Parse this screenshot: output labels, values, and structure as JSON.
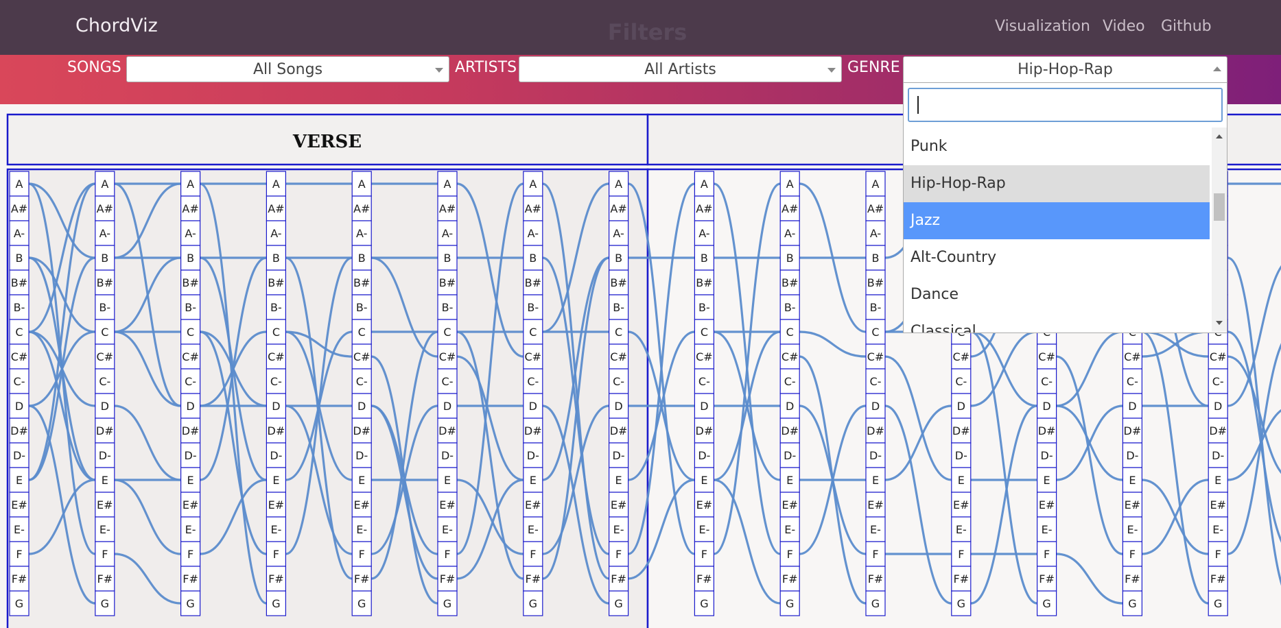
{
  "nav": {
    "brand": "ChordViz",
    "center_title": "Filters",
    "links": [
      "Visualization",
      "Video",
      "Github"
    ]
  },
  "filters": {
    "songs_label": "SONGS",
    "songs_value": "All Songs",
    "artists_label": "ARTISTS",
    "artists_value": "All Artists",
    "genre_label": "GENRE",
    "genre_value": "Hip-Hop-Rap"
  },
  "genre_dropdown": {
    "search_value": "",
    "options": [
      "Punk",
      "Hip-Hop-Rap",
      "Jazz",
      "Alt-Country",
      "Dance",
      "Classical"
    ],
    "hovered": "Hip-Hop-Rap",
    "highlighted": "Jazz"
  },
  "sections": [
    {
      "label": "VERSE"
    },
    {
      "label": ""
    }
  ],
  "notes": [
    "A",
    "A#",
    "A-",
    "B",
    "B#",
    "B-",
    "C",
    "C#",
    "C-",
    "D",
    "D#",
    "D-",
    "E",
    "E#",
    "E-",
    "F",
    "F#",
    "G"
  ],
  "colors": {
    "link": "#5b8ccc",
    "column_border": "#1a1acc",
    "section_border": "#1a1acc",
    "dropdown_highlight": "#5897fb",
    "nav_bg": "#4c3a4b"
  },
  "chart_data": {
    "type": "chord-transition-flow",
    "columns": 16,
    "rows": [
      "A",
      "A#",
      "A-",
      "B",
      "B#",
      "B-",
      "C",
      "C#",
      "C-",
      "D",
      "D#",
      "D-",
      "E",
      "E#",
      "E-",
      "F",
      "F#",
      "G"
    ],
    "transitions": [
      [
        [
          0,
          3
        ],
        [
          3,
          6
        ],
        [
          6,
          12
        ],
        [
          12,
          0
        ],
        [
          9,
          6
        ],
        [
          6,
          0
        ],
        [
          0,
          15
        ],
        [
          15,
          12
        ],
        [
          3,
          12
        ],
        [
          12,
          3
        ],
        [
          6,
          9
        ],
        [
          9,
          17
        ]
      ],
      [
        [
          0,
          0
        ],
        [
          3,
          3
        ],
        [
          6,
          9
        ],
        [
          12,
          15
        ],
        [
          9,
          12
        ],
        [
          6,
          6
        ],
        [
          3,
          0
        ],
        [
          12,
          12
        ],
        [
          15,
          17
        ],
        [
          6,
          3
        ],
        [
          0,
          9
        ]
      ],
      [
        [
          0,
          0
        ],
        [
          3,
          3
        ],
        [
          9,
          6
        ],
        [
          6,
          9
        ],
        [
          15,
          12
        ],
        [
          12,
          3
        ],
        [
          9,
          9
        ],
        [
          6,
          15
        ],
        [
          3,
          12
        ],
        [
          0,
          17
        ]
      ],
      [
        [
          0,
          0
        ],
        [
          6,
          12
        ],
        [
          3,
          3
        ],
        [
          9,
          15
        ],
        [
          12,
          6
        ],
        [
          6,
          7
        ],
        [
          9,
          9
        ],
        [
          3,
          16
        ],
        [
          15,
          3
        ]
      ],
      [
        [
          3,
          7
        ],
        [
          9,
          15
        ],
        [
          6,
          6
        ],
        [
          12,
          12
        ],
        [
          15,
          9
        ],
        [
          3,
          3
        ],
        [
          7,
          17
        ],
        [
          0,
          0
        ],
        [
          9,
          16
        ],
        [
          16,
          6
        ]
      ],
      [
        [
          6,
          6
        ],
        [
          7,
          12
        ],
        [
          12,
          15
        ],
        [
          9,
          9
        ],
        [
          15,
          0
        ],
        [
          3,
          3
        ],
        [
          0,
          7
        ],
        [
          16,
          12
        ],
        [
          6,
          16
        ]
      ],
      [
        [
          6,
          0
        ],
        [
          12,
          3
        ],
        [
          15,
          9
        ],
        [
          9,
          17
        ],
        [
          3,
          15
        ],
        [
          0,
          16
        ],
        [
          6,
          6
        ],
        [
          16,
          3
        ]
      ],
      [
        [
          3,
          3
        ],
        [
          6,
          12
        ],
        [
          12,
          6
        ],
        [
          9,
          9
        ],
        [
          0,
          15
        ],
        [
          15,
          0
        ],
        [
          16,
          12
        ]
      ],
      [
        [
          3,
          3
        ],
        [
          6,
          12
        ],
        [
          12,
          6
        ],
        [
          9,
          9
        ],
        [
          0,
          15
        ],
        [
          15,
          0
        ],
        [
          6,
          6
        ],
        [
          12,
          17
        ]
      ],
      [
        [
          3,
          3
        ],
        [
          6,
          7
        ],
        [
          12,
          12
        ],
        [
          9,
          15
        ],
        [
          15,
          9
        ],
        [
          0,
          6
        ],
        [
          7,
          17
        ]
      ],
      [
        [
          3,
          0
        ],
        [
          6,
          6
        ],
        [
          7,
          12
        ],
        [
          12,
          9
        ],
        [
          9,
          17
        ],
        [
          15,
          15
        ],
        [
          6,
          3
        ]
      ],
      [
        [
          6,
          9
        ],
        [
          12,
          12
        ],
        [
          9,
          6
        ],
        [
          15,
          15
        ],
        [
          7,
          3
        ],
        [
          17,
          9
        ],
        [
          6,
          17
        ]
      ],
      [
        [
          6,
          6
        ],
        [
          9,
          12
        ],
        [
          12,
          9
        ],
        [
          15,
          17
        ],
        [
          7,
          15
        ],
        [
          3,
          3
        ],
        [
          9,
          6
        ]
      ],
      [
        [
          6,
          7
        ],
        [
          12,
          15
        ],
        [
          9,
          9
        ],
        [
          15,
          12
        ],
        [
          7,
          6
        ],
        [
          3,
          9
        ],
        [
          6,
          17
        ]
      ],
      [
        [
          7,
          12
        ],
        [
          9,
          3
        ],
        [
          12,
          9
        ],
        [
          15,
          6
        ],
        [
          6,
          15
        ],
        [
          0,
          0
        ],
        [
          3,
          17
        ]
      ]
    ]
  }
}
